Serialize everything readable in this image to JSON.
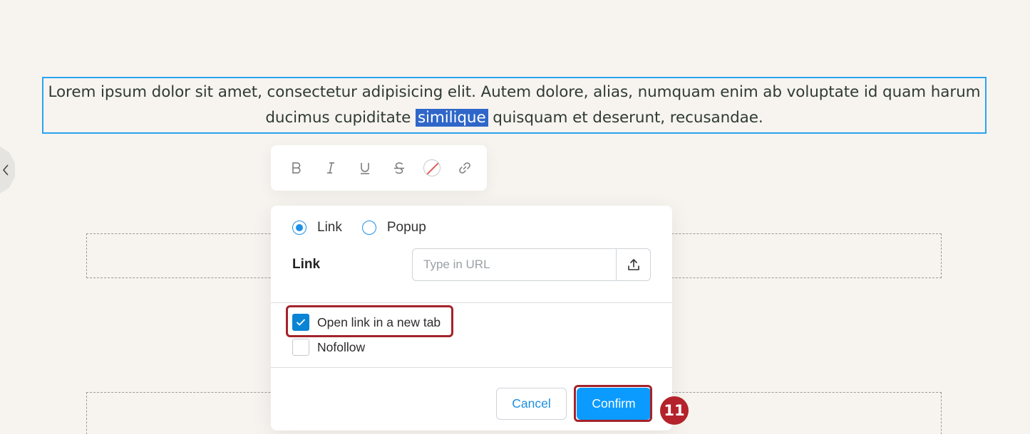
{
  "editor": {
    "paragraph_before": "Lorem ipsum dolor sit amet, consectetur adipisicing elit. Autem dolore, alias, numquam enim ab voluptate id quam harum ducimus cupiditate ",
    "selected_word": "similique",
    "paragraph_after": " quisquam et deserunt, recusandae."
  },
  "toolbar": {
    "buttons": [
      {
        "name": "bold-icon",
        "label": "B"
      },
      {
        "name": "italic-icon",
        "label": "I"
      },
      {
        "name": "underline-icon",
        "label": "U"
      },
      {
        "name": "strikethrough-icon",
        "label": "S"
      },
      {
        "name": "text-color-none-icon",
        "label": ""
      },
      {
        "name": "link-icon",
        "label": ""
      }
    ]
  },
  "link_panel": {
    "type_options": [
      {
        "label": "Link",
        "checked": true
      },
      {
        "label": "Popup",
        "checked": false
      }
    ],
    "link_label": "Link",
    "url_input": {
      "value": "",
      "placeholder": "Type in URL"
    },
    "open_new_tab": {
      "label": "Open link in a new tab",
      "checked": true
    },
    "nofollow": {
      "label": "Nofollow",
      "checked": false
    },
    "cancel_label": "Cancel",
    "confirm_label": "Confirm"
  },
  "annotation": {
    "step_number": "11",
    "highlight_color": "#a3232b"
  },
  "colors": {
    "accent": "#0b9bff",
    "selection": "#2f66c9",
    "focus_border": "#2aa3f0"
  }
}
